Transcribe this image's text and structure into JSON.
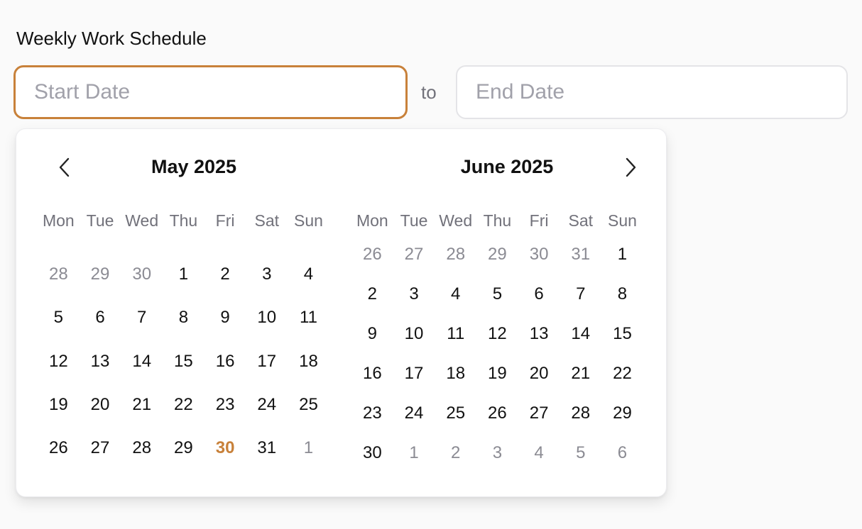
{
  "form": {
    "label": "Weekly Work Schedule",
    "start_placeholder": "Start Date",
    "start_value": "",
    "end_placeholder": "End Date",
    "end_value": "",
    "separator": "to"
  },
  "colors": {
    "accent": "#c8813a",
    "muted_text": "#8b8b93",
    "weekday_text": "#71717a"
  },
  "icons": {
    "prev": "chevron-left-icon",
    "next": "chevron-right-icon"
  },
  "calendar": {
    "weekdays": [
      "Mon",
      "Tue",
      "Wed",
      "Thu",
      "Fri",
      "Sat",
      "Sun"
    ],
    "today": "May 30 2025",
    "months": [
      {
        "title": "May 2025",
        "weeks": [
          [
            {
              "d": "28",
              "out": true
            },
            {
              "d": "29",
              "out": true
            },
            {
              "d": "30",
              "out": true
            },
            {
              "d": "1"
            },
            {
              "d": "2"
            },
            {
              "d": "3"
            },
            {
              "d": "4"
            }
          ],
          [
            {
              "d": "5"
            },
            {
              "d": "6"
            },
            {
              "d": "7"
            },
            {
              "d": "8"
            },
            {
              "d": "9"
            },
            {
              "d": "10"
            },
            {
              "d": "11"
            }
          ],
          [
            {
              "d": "12"
            },
            {
              "d": "13"
            },
            {
              "d": "14"
            },
            {
              "d": "15"
            },
            {
              "d": "16"
            },
            {
              "d": "17"
            },
            {
              "d": "18"
            }
          ],
          [
            {
              "d": "19"
            },
            {
              "d": "20"
            },
            {
              "d": "21"
            },
            {
              "d": "22"
            },
            {
              "d": "23"
            },
            {
              "d": "24"
            },
            {
              "d": "25"
            }
          ],
          [
            {
              "d": "26"
            },
            {
              "d": "27"
            },
            {
              "d": "28"
            },
            {
              "d": "29"
            },
            {
              "d": "30",
              "today": true
            },
            {
              "d": "31"
            },
            {
              "d": "1",
              "out": true
            }
          ]
        ]
      },
      {
        "title": "June 2025",
        "weeks": [
          [
            {
              "d": "26",
              "out": true
            },
            {
              "d": "27",
              "out": true
            },
            {
              "d": "28",
              "out": true
            },
            {
              "d": "29",
              "out": true
            },
            {
              "d": "30",
              "out": true
            },
            {
              "d": "31",
              "out": true
            },
            {
              "d": "1"
            }
          ],
          [
            {
              "d": "2"
            },
            {
              "d": "3"
            },
            {
              "d": "4"
            },
            {
              "d": "5"
            },
            {
              "d": "6"
            },
            {
              "d": "7"
            },
            {
              "d": "8"
            }
          ],
          [
            {
              "d": "9"
            },
            {
              "d": "10"
            },
            {
              "d": "11"
            },
            {
              "d": "12"
            },
            {
              "d": "13"
            },
            {
              "d": "14"
            },
            {
              "d": "15"
            }
          ],
          [
            {
              "d": "16"
            },
            {
              "d": "17"
            },
            {
              "d": "18"
            },
            {
              "d": "19"
            },
            {
              "d": "20"
            },
            {
              "d": "21"
            },
            {
              "d": "22"
            }
          ],
          [
            {
              "d": "23"
            },
            {
              "d": "24"
            },
            {
              "d": "25"
            },
            {
              "d": "26"
            },
            {
              "d": "27"
            },
            {
              "d": "28"
            },
            {
              "d": "29"
            }
          ],
          [
            {
              "d": "30"
            },
            {
              "d": "1",
              "out": true
            },
            {
              "d": "2",
              "out": true
            },
            {
              "d": "3",
              "out": true
            },
            {
              "d": "4",
              "out": true
            },
            {
              "d": "5",
              "out": true
            },
            {
              "d": "6",
              "out": true
            }
          ]
        ]
      }
    ]
  }
}
